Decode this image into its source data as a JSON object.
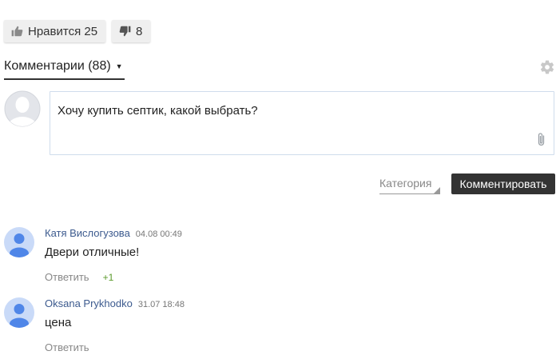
{
  "reactions": {
    "like_label": "Нравится 25",
    "dislike_label": "8"
  },
  "comments_header": {
    "tab_label": "Комментарии (88)"
  },
  "compose": {
    "value": "Хочу купить септик, какой выбрать?"
  },
  "actions": {
    "category_label": "Категория",
    "submit_label": "Комментировать"
  },
  "comments": [
    {
      "author": "Катя Вислогузова",
      "date": "04.08 00:49",
      "text": "Двери отличные!",
      "reply_label": "Ответить",
      "score": "+1"
    },
    {
      "author": "Oksana Prykhodko",
      "date": "31.07 18:48",
      "text": "цена",
      "reply_label": "Ответить"
    }
  ],
  "colors": {
    "author_link": "#3c5a8e",
    "score_positive": "#5b9a2c",
    "submit_bg": "#333333",
    "avatar_blue": "#4f86e8",
    "avatar_bg": "#c9daf8"
  },
  "icons": {
    "like": "thumbs-up-icon",
    "dislike": "thumbs-down-icon",
    "settings": "gear-icon",
    "attach": "paperclip-icon",
    "avatar": "user-avatar-icon"
  }
}
